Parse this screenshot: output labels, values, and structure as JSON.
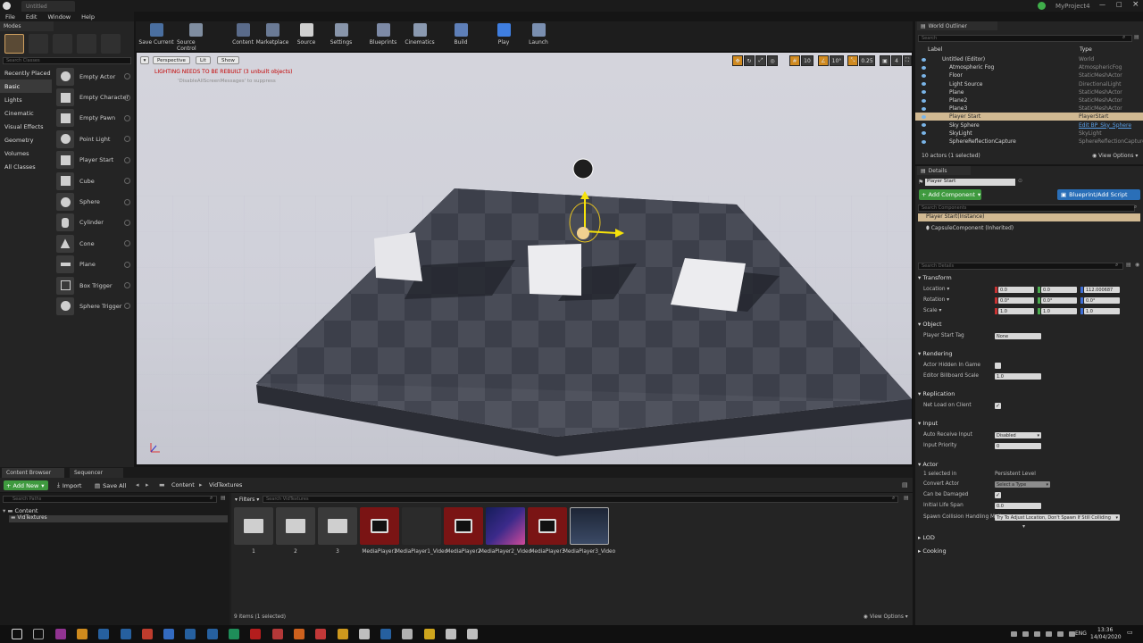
{
  "window": {
    "title": "Untitled",
    "project": "MyProject4"
  },
  "menu": [
    "File",
    "Edit",
    "Window",
    "Help"
  ],
  "modes": {
    "tab": "Modes",
    "search_placeholder": "Search Classes",
    "categories": [
      "Recently Placed",
      "Basic",
      "Lights",
      "Cinematic",
      "Visual Effects",
      "Geometry",
      "Volumes",
      "All Classes"
    ],
    "active_category": "Basic",
    "items": [
      "Empty Actor",
      "Empty Character",
      "Empty Pawn",
      "Point Light",
      "Player Start",
      "Cube",
      "Sphere",
      "Cylinder",
      "Cone",
      "Plane",
      "Box Trigger",
      "Sphere Trigger"
    ]
  },
  "toolbar": [
    "Save Current",
    "Source Control",
    "Content",
    "Marketplace",
    "Source",
    "Settings",
    "Blueprints",
    "Cinematics",
    "Build",
    "Play",
    "Launch"
  ],
  "viewport": {
    "perspective": "Perspective",
    "lit": "Lit",
    "show": "Show",
    "warning": "LIGHTING NEEDS TO BE REBUILT (3 unbuilt objects)",
    "suppress": "'DisableAllScreenMessages' to suppress",
    "grid": "10",
    "angle": "10°",
    "scale": "0.25",
    "camera": "4"
  },
  "content_browser": {
    "tabs": [
      "Content Browser",
      "Sequencer"
    ],
    "add_new": "Add New",
    "import": "Import",
    "save_all": "Save All",
    "path": [
      "Content",
      "VidTextures"
    ],
    "search_paths": "Search Paths",
    "filters": "Filters",
    "search_assets": "Search VidTextures",
    "tree": [
      "Content",
      "VidTextures"
    ],
    "assets": [
      "1",
      "2",
      "3",
      "MediaPlayer1",
      "MediaPlayer1_Video",
      "MediaPlayer2",
      "MediaPlayer2_Video",
      "MediaPlayer3",
      "MediaPlayer3_Video"
    ],
    "status": "9 items (1 selected)",
    "view_options": "View Options"
  },
  "outliner": {
    "title": "World Outliner",
    "search_placeholder": "Search",
    "col_label": "Label",
    "col_type": "Type",
    "rows": [
      {
        "name": "Untitled (Editor)",
        "type": "World"
      },
      {
        "name": "Atmospheric Fog",
        "type": "AtmosphericFog"
      },
      {
        "name": "Floor",
        "type": "StaticMeshActor"
      },
      {
        "name": "Light Source",
        "type": "DirectionalLight"
      },
      {
        "name": "Plane",
        "type": "StaticMeshActor"
      },
      {
        "name": "Plane2",
        "type": "StaticMeshActor"
      },
      {
        "name": "Plane3",
        "type": "StaticMeshActor"
      },
      {
        "name": "Player Start",
        "type": "PlayerStart"
      },
      {
        "name": "Sky Sphere",
        "type": "Edit BP_Sky_Sphere"
      },
      {
        "name": "SkyLight",
        "type": "SkyLight"
      },
      {
        "name": "SphereReflectionCapture",
        "type": "SphereReflectionCapture"
      }
    ],
    "status": "10 actors (1 selected)",
    "view_options": "View Options"
  },
  "details": {
    "title": "Details",
    "actor_name": "Player Start",
    "add_component": "+ Add Component",
    "blueprint": "Blueprint/Add Script",
    "search_components": "Search Components",
    "components": [
      "Player Start(Instance)",
      "CapsuleComponent (Inherited)"
    ],
    "search_details": "Search Details",
    "transform": "Transform",
    "location": "Location",
    "rotation": "Rotation",
    "scale": "Scale",
    "loc": [
      "0.0",
      "0.0",
      "112.000687"
    ],
    "rot": [
      "0.0°",
      "0.0°",
      "0.0°"
    ],
    "scl": [
      "1.0",
      "1.0",
      "1.0"
    ],
    "object": "Object",
    "player_start_tag": "Player Start Tag",
    "tag_value": "None",
    "rendering": "Rendering",
    "actor_hidden": "Actor Hidden In Game",
    "billboard_scale": "Editor Billboard Scale",
    "billboard_value": "1.0",
    "replication": "Replication",
    "net_load": "Net Load on Client",
    "input": "Input",
    "auto_receive": "Auto Receive Input",
    "auto_value": "Disabled",
    "input_priority": "Input Priority",
    "priority_value": "0",
    "actor": "Actor",
    "selected_in": "1 selected in",
    "level": "Persistent Level",
    "convert_actor": "Convert Actor",
    "convert_value": "Select a Type",
    "can_be_damaged": "Can be Damaged",
    "initial_life": "Initial Life Span",
    "life_value": "0.0",
    "spawn_collision": "Spawn Collision Handling Meth",
    "spawn_value": "Try To Adjust Location, Don't Spawn If Still Colliding",
    "lod": "LOD",
    "cooking": "Cooking"
  },
  "taskbar": {
    "time": "13:36",
    "date": "14/04/2020",
    "lang": "ENG"
  }
}
